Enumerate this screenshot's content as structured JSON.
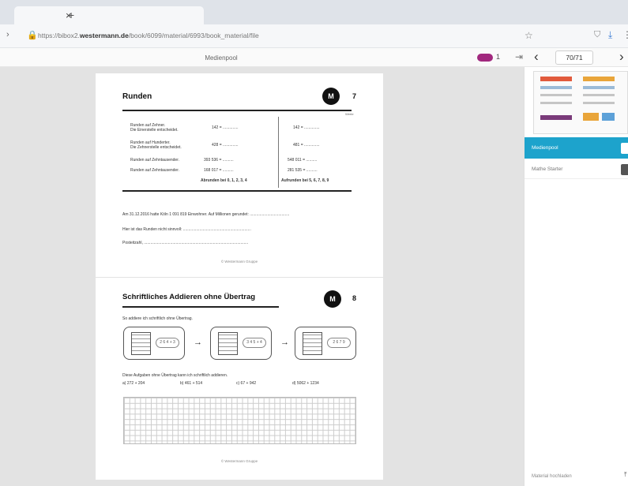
{
  "browser": {
    "url_prefix": "https://bibox2.",
    "url_domain": "westermann.de",
    "url_path": "/book/6099/material/6993/book_material/file"
  },
  "app": {
    "title": "Medienpool",
    "toggle_count": "1",
    "page_indicator": "70/71"
  },
  "page1": {
    "title": "Runden",
    "badge": "M",
    "page_no": "7",
    "col_right_head": "Werte",
    "rows": [
      {
        "label1": "Runden auf Zehner.",
        "label2": "Die Einerstelle entscheidet.",
        "a": "142 = ..............",
        "b": "142 = .............."
      },
      {
        "label1": "Runden auf Hunderter.",
        "label2": "Die Zehnerstelle entscheidet.",
        "a": "428 = ..............",
        "b": "481 = .............."
      },
      {
        "label1": "Runden auf Zehntausender.",
        "label2": "",
        "a": "393 536 = ..........",
        "b": "548 011 = .........."
      },
      {
        "label1": "Runden auf Zehntausender.",
        "label2": "",
        "a": "168 017 = ..........",
        "b": "281 535 = .........."
      }
    ],
    "rule_left": "Abrunden bei 0, 1, 2, 3, 4",
    "rule_right": "Aufrunden bei 5, 6, 7, 8, 9",
    "sentence1": "Am 31.12.2016 hatte Köln 1 091 819 Einwohner. Auf Millionen gerundet: ....................................",
    "sentence2": "Hier ist das Runden nicht sinnvoll: ..............................................................",
    "sentence3": "Posteitzahl, ...............................................................................................",
    "footer": "© Westermann Gruppe"
  },
  "page2": {
    "title": "Schriftliches Addieren ohne Übertrag",
    "badge": "M",
    "page_no": "8",
    "subtitle": "So addiere ich schriftlich ohne Übertrag.",
    "ovals": [
      "2 6 4 + 3",
      "3 4 5 + 4",
      "2 6 7 9"
    ],
    "instruction": "Diese Aufgaben ohne Übertrag kann ich schriftlich addieren.",
    "tasks": [
      "a) 272 + 204",
      "b) 461 + 514",
      "c) 67 + 942",
      "d) 5062 + 1234"
    ],
    "footer": "© Westermann Gruppe"
  },
  "sidebar": {
    "item1": "Medienpool",
    "item2": "Mathe Starter",
    "bottom": "Material hochladen"
  },
  "colors": {
    "accent": "#1da3cc",
    "toggle": "#a1287e"
  }
}
